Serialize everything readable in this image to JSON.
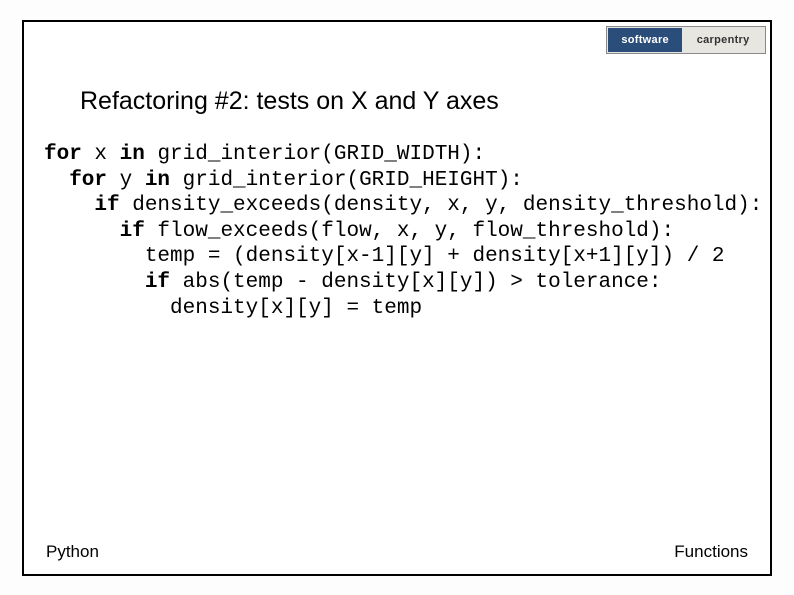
{
  "logo": {
    "left": "software",
    "right": "carpentry"
  },
  "title": "Refactoring #2: tests on X and Y axes",
  "code": {
    "l1a": "for",
    "l1b": " x ",
    "l1c": "in",
    "l1d": " grid_interior(GRID_WIDTH):",
    "l2a": "  for",
    "l2b": " y ",
    "l2c": "in",
    "l2d": " grid_interior(GRID_HEIGHT):",
    "l3a": "    if",
    "l3b": " density_exceeds(density, x, y, density_threshold):",
    "l4a": "      if",
    "l4b": " flow_exceeds(flow, x, y, flow_threshold):",
    "l5": "        temp = (density[x-1][y] + density[x+1][y]) / 2",
    "l6a": "        if",
    "l6b": " abs(temp - density[x][y]) > tolerance:",
    "l7": "          density[x][y] = temp"
  },
  "footer": {
    "left": "Python",
    "right": "Functions"
  }
}
